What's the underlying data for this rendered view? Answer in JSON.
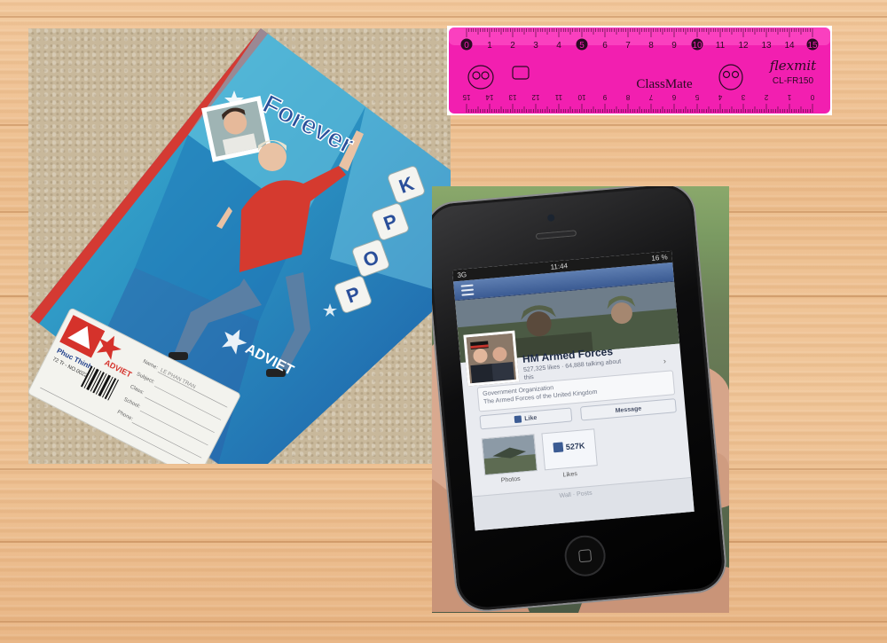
{
  "notebook": {
    "title_line1": "Forever",
    "title_letters": [
      "K",
      "P",
      "O",
      "P"
    ],
    "brand": "ADVIET",
    "brand_cover": "ADVIET",
    "publisher": "Phuc Thinh",
    "code": "72 Tr - NO.0022",
    "label_fields": [
      "Name:",
      "Subject:",
      "Class:",
      "School:",
      "Phone:"
    ],
    "label_name_value": "LE PHAN TRAN"
  },
  "ruler": {
    "brand": "ClassMate",
    "logo": "flexmit",
    "model": "CL-FR150",
    "top_numbers": [
      "0",
      "1",
      "2",
      "3",
      "4",
      "5",
      "6",
      "7",
      "8",
      "9",
      "10",
      "11",
      "12",
      "13",
      "14",
      "15"
    ],
    "bottom_numbers": [
      "15",
      "14",
      "13",
      "12",
      "11",
      "10",
      "9",
      "8",
      "7",
      "6",
      "5",
      "4",
      "3",
      "2",
      "1",
      "0"
    ],
    "color": "#f21fb0"
  },
  "phone_screen": {
    "time": "11:44",
    "carrier": "3G",
    "battery": "16 %",
    "page_name": "HM Armed Forces",
    "stats": "527,325 likes · 64,888 talking about this",
    "category": "Government Organization",
    "description": "The Armed Forces of the United Kingdom",
    "like_button": "Like",
    "message_button": "Message",
    "likes_count": "527K",
    "photos_label": "Photos",
    "likes_label": "Likes",
    "next_row": "Wall · Posts",
    "nav_color": "#3b5b93"
  }
}
